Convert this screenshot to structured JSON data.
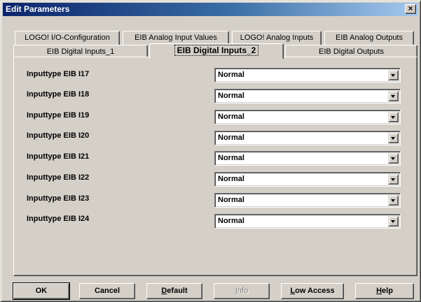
{
  "window": {
    "title": "Edit Parameters",
    "close_glyph": "×"
  },
  "tabs_back_row": [
    {
      "label": "LOGO! I/O-Configuration"
    },
    {
      "label": "EIB Analog Input Values"
    },
    {
      "label": "LOGO! Analog Inputs"
    },
    {
      "label": "EIB Analog Outputs"
    }
  ],
  "tabs_front_row": [
    {
      "label": "EIB Digital Inputs_1"
    },
    {
      "label": "EIB Digital Inputs_2",
      "active": true
    },
    {
      "label": "EIB Digital Outputs"
    }
  ],
  "rows": [
    {
      "label": "Inputtype EIB I17",
      "value": "Normal"
    },
    {
      "label": "Inputtype EIB I18",
      "value": "Normal"
    },
    {
      "label": "Inputtype EIB I19",
      "value": "Normal"
    },
    {
      "label": "Inputtype EIB I20",
      "value": "Normal"
    },
    {
      "label": "Inputtype EIB I21",
      "value": "Normal"
    },
    {
      "label": "Inputtype EIB I22",
      "value": "Normal"
    },
    {
      "label": "Inputtype EIB I23",
      "value": "Normal"
    },
    {
      "label": "Inputtype EIB I24",
      "value": "Normal"
    }
  ],
  "buttons": {
    "ok": "OK",
    "cancel": "Cancel",
    "default_first": "D",
    "default_rest": "efault",
    "info_first": "I",
    "info_rest": "nfo",
    "low_access_first": "L",
    "low_access_rest": "ow Access",
    "help_first": "H",
    "help_rest": "elp"
  }
}
